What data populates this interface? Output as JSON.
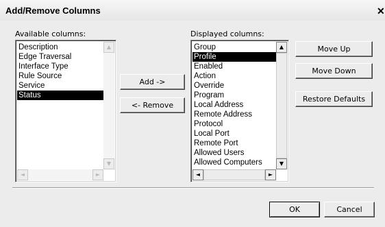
{
  "dialog": {
    "title": "Add/Remove Columns",
    "close_glyph": "✕"
  },
  "available": {
    "label": "Available columns:",
    "items": [
      {
        "label": "Description",
        "selected": false
      },
      {
        "label": "Edge Traversal",
        "selected": false
      },
      {
        "label": "Interface Type",
        "selected": false
      },
      {
        "label": "Rule Source",
        "selected": false
      },
      {
        "label": "Service",
        "selected": false
      },
      {
        "label": "Status",
        "selected": true
      }
    ]
  },
  "displayed": {
    "label": "Displayed columns:",
    "items": [
      {
        "label": "Group",
        "selected": false
      },
      {
        "label": "Profile",
        "selected": true
      },
      {
        "label": "Enabled",
        "selected": false
      },
      {
        "label": "Action",
        "selected": false
      },
      {
        "label": "Override",
        "selected": false
      },
      {
        "label": "Program",
        "selected": false
      },
      {
        "label": "Local Address",
        "selected": false
      },
      {
        "label": "Remote Address",
        "selected": false
      },
      {
        "label": "Protocol",
        "selected": false
      },
      {
        "label": "Local Port",
        "selected": false
      },
      {
        "label": "Remote Port",
        "selected": false
      },
      {
        "label": "Allowed Users",
        "selected": false
      },
      {
        "label": "Allowed Computers",
        "selected": false
      }
    ]
  },
  "buttons": {
    "add": "Add ->",
    "remove": "<- Remove",
    "move_up": "Move Up",
    "move_down": "Move Down",
    "restore_defaults": "Restore Defaults",
    "ok": "OK",
    "cancel": "Cancel"
  },
  "icons": {
    "arrow_up": "▲",
    "arrow_down": "▼",
    "arrow_left": "◄",
    "arrow_right": "►"
  }
}
